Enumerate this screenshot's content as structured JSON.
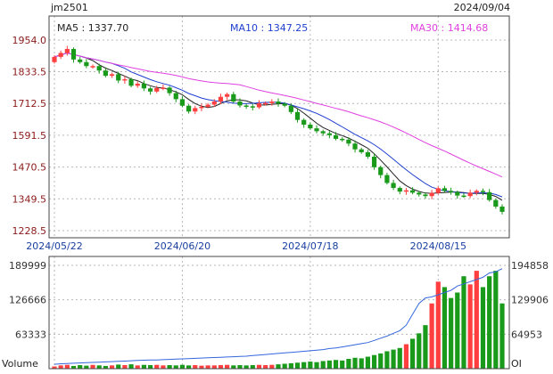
{
  "header": {
    "symbol": "jm2501",
    "date": "2024/09/04"
  },
  "legend": [
    {
      "label": "MA5 : 1337.70",
      "color": "#222222"
    },
    {
      "label": "MA10 : 1347.25",
      "color": "#1f3fd0"
    },
    {
      "label": "MA30 : 1414.68",
      "color": "#e040e0"
    }
  ],
  "colors": {
    "up": "#ff3f3f",
    "down": "#1a9a1a",
    "oi": "#3366dd",
    "grid": "#b7b7b7",
    "axis": "#444444"
  },
  "volume_panel": {
    "label": "Volume",
    "oi_label": "OI"
  },
  "chart_data": [
    {
      "type": "candlestick",
      "title": "",
      "ylim": [
        1228.5,
        1954.0
      ],
      "y_ticks": [
        "1954.0",
        "1833.5",
        "1712.5",
        "1591.5",
        "1470.5",
        "1349.5",
        "1228.5"
      ],
      "x_ticks": [
        "2024/05/22",
        "2024/06/20",
        "2024/07/18",
        "2024/08/15"
      ],
      "x_tick_index": [
        0,
        20,
        40,
        60
      ],
      "closes": [
        1890,
        1905,
        1920,
        1880,
        1870,
        1855,
        1855,
        1838,
        1818,
        1824,
        1800,
        1805,
        1780,
        1788,
        1770,
        1758,
        1771,
        1773,
        1752,
        1729,
        1704,
        1682,
        1695,
        1700,
        1708,
        1720,
        1738,
        1748,
        1720,
        1705,
        1702,
        1698,
        1713,
        1714,
        1720,
        1712,
        1704,
        1680,
        1650,
        1632,
        1618,
        1607,
        1599,
        1592,
        1578,
        1575,
        1560,
        1538,
        1527,
        1510,
        1470,
        1440,
        1410,
        1391,
        1377,
        1382,
        1373,
        1366,
        1360,
        1372,
        1390,
        1380,
        1375,
        1362,
        1360,
        1373,
        1380,
        1375,
        1345,
        1320,
        1300
      ]
    },
    {
      "type": "bar",
      "title": "",
      "ylim": [
        0,
        189999
      ],
      "y_ticks": [
        "189999",
        "126666",
        "63333"
      ],
      "y2_ticks": [
        "194858",
        "129906",
        "64953"
      ],
      "volume": [
        4000,
        6000,
        7000,
        5000,
        6500,
        5500,
        7000,
        6000,
        5000,
        6000,
        7500,
        6500,
        8000,
        6000,
        7000,
        6500,
        7000,
        6000,
        6500,
        6000,
        7000,
        6000,
        6500,
        5500,
        6000,
        6000,
        6500,
        7000,
        6000,
        6500,
        6000,
        6500,
        7000,
        6500,
        7000,
        8000,
        9000,
        10000,
        11000,
        12000,
        13000,
        12000,
        14000,
        15000,
        16000,
        15000,
        18000,
        20000,
        19000,
        22000,
        25000,
        28000,
        32000,
        35000,
        38000,
        45000,
        55000,
        65000,
        80000,
        120000,
        160000,
        150000,
        130000,
        140000,
        170000,
        155000,
        180000,
        150000,
        170000,
        180000,
        120000
      ],
      "open_interest": [
        8000,
        9000,
        9500,
        10000,
        10500,
        11000,
        11500,
        12000,
        12500,
        13000,
        13500,
        14000,
        14500,
        15000,
        15500,
        16000,
        16000,
        16500,
        17000,
        17500,
        18000,
        18500,
        19000,
        19500,
        20000,
        20500,
        21000,
        21500,
        22000,
        22500,
        23000,
        24000,
        25000,
        26000,
        27000,
        28000,
        29000,
        30000,
        31000,
        32000,
        33000,
        34000,
        35000,
        37000,
        38000,
        40000,
        42000,
        44000,
        46000,
        48000,
        52000,
        56000,
        60000,
        65000,
        70000,
        80000,
        100000,
        120000,
        130000,
        132000,
        136000,
        140000,
        144000,
        152000,
        156000,
        160000,
        164000,
        168000,
        176000,
        178000,
        184000
      ]
    }
  ]
}
